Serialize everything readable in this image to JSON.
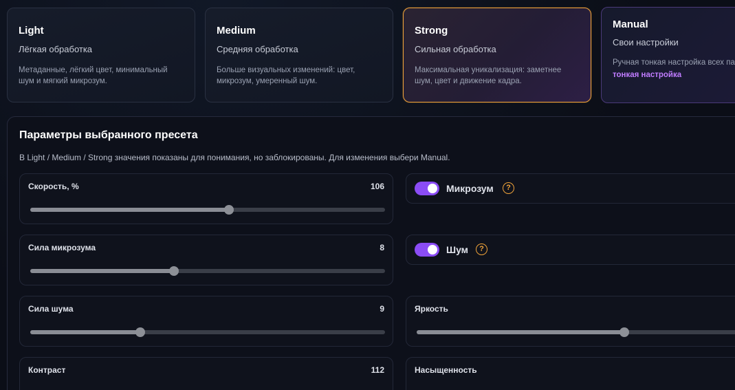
{
  "presets": [
    {
      "id": "light",
      "title": "Light",
      "subtitle": "Лёгкая обработка",
      "description": "Метаданные, лёгкий цвет, минимальный шум и мягкий микрозум.",
      "selected": false
    },
    {
      "id": "medium",
      "title": "Medium",
      "subtitle": "Средняя обработка",
      "description": "Больше визуальных изменений: цвет, микрозум, умеренный шум.",
      "selected": false
    },
    {
      "id": "strong",
      "title": "Strong",
      "subtitle": "Сильная обработка",
      "description": "Максимальная уникализация: заметнее шум, цвет и движение кадра.",
      "selected": true
    },
    {
      "id": "manual",
      "title": "Manual",
      "subtitle": "Свои настройки",
      "description": "Ручная тонкая настройка всех параметров.",
      "link": "тонкая настройка",
      "selected": false
    }
  ],
  "params": {
    "title": "Параметры выбранного пресета",
    "note": "В Light / Medium / Strong значения показаны для понимания, но заблокированы. Для изменения выбери Manual.",
    "speed": {
      "label": "Скорость, %",
      "value": "106",
      "fraction": 0.56
    },
    "microzoom_strength": {
      "label": "Сила микрозума",
      "value": "8",
      "fraction": 0.405
    },
    "noise_strength": {
      "label": "Сила шума",
      "value": "9",
      "fraction": 0.31
    },
    "brightness": {
      "label": "Яркость",
      "fraction": 0.59
    },
    "contrast": {
      "label": "Контраст",
      "value": "112"
    },
    "saturation": {
      "label": "Насыщенность"
    },
    "microzoom_toggle": {
      "label": "Микрозум",
      "on": true
    },
    "noise_toggle": {
      "label": "Шум",
      "on": true
    },
    "help_glyph": "?"
  },
  "colors": {
    "accent_purple": "#8b4cf5",
    "accent_orange": "#f0a33a",
    "link_purple": "#c07cff"
  }
}
